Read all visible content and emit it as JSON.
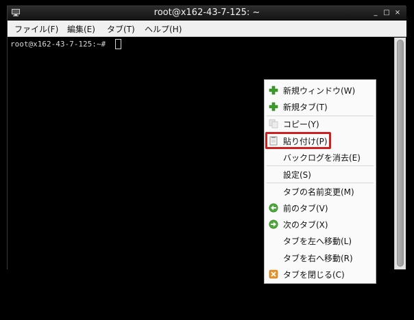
{
  "window": {
    "title": "root@x162-43-7-125: ~",
    "controls": {
      "minimize": "_",
      "maximize": "□",
      "close": "×"
    }
  },
  "menubar": {
    "file": "ファイル(F)",
    "edit": "編集(E)",
    "tabs": "タブ(T)",
    "help": "ヘルプ(H)"
  },
  "terminal": {
    "prompt": "root@x162-43-7-125:~# "
  },
  "context_menu": {
    "items": [
      {
        "label": "新規ウィンドウ(W)",
        "icon": "plus-icon"
      },
      {
        "label": "新規タブ(T)",
        "icon": "plus-icon"
      },
      {
        "label": "コピー(Y)",
        "icon": "copy-icon"
      },
      {
        "label": "貼り付け(P)",
        "icon": "paste-icon"
      },
      {
        "label": "バックログを消去(E)",
        "icon": ""
      },
      {
        "label": "設定(S)",
        "icon": ""
      },
      {
        "label": "タブの名前変更(M)",
        "icon": ""
      },
      {
        "label": "前のタブ(V)",
        "icon": "arrow-left-icon"
      },
      {
        "label": "次のタブ(X)",
        "icon": "arrow-right-icon"
      },
      {
        "label": "タブを左へ移動(L)",
        "icon": ""
      },
      {
        "label": "タブを右へ移動(R)",
        "icon": ""
      },
      {
        "label": "タブを閉じる(C)",
        "icon": "close-tab-icon"
      }
    ]
  },
  "colors": {
    "highlight": "#cc1f1f",
    "plus_green": "#3c9a2a",
    "nav_green": "#4da83a",
    "close_orange": "#e8932a"
  }
}
